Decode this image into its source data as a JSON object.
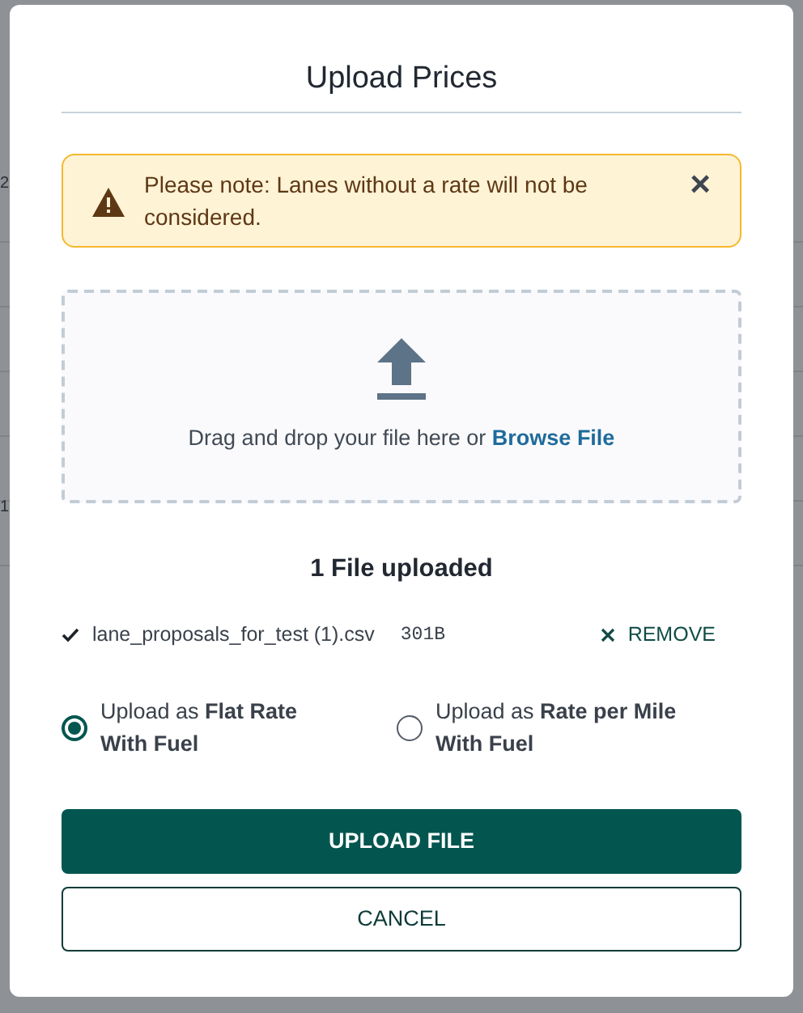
{
  "background": {
    "fragments": [
      "2",
      "1"
    ]
  },
  "dialog": {
    "title": "Upload Prices",
    "alert": {
      "text": "Please note: Lanes without a rate will not be considered.",
      "close": "×"
    },
    "dropzone": {
      "text": "Drag and drop your file here or",
      "link": "Browse File"
    },
    "uploaded_heading": "1 File uploaded",
    "files": [
      {
        "name": "lane_proposals_for_test (1).csv",
        "size": "301B",
        "done": true,
        "remove": "REMOVE"
      }
    ],
    "options": [
      {
        "label": "Upload as **Flat Rate With Fuel**",
        "selected": true
      },
      {
        "label": "Upload as **Rate per Mile With Fuel**",
        "selected": false
      }
    ],
    "buttons": [
      {
        "label": "UPLOAD FILE",
        "kind": "primary"
      },
      {
        "label": "CANCEL",
        "kind": "secondary"
      }
    ]
  }
}
